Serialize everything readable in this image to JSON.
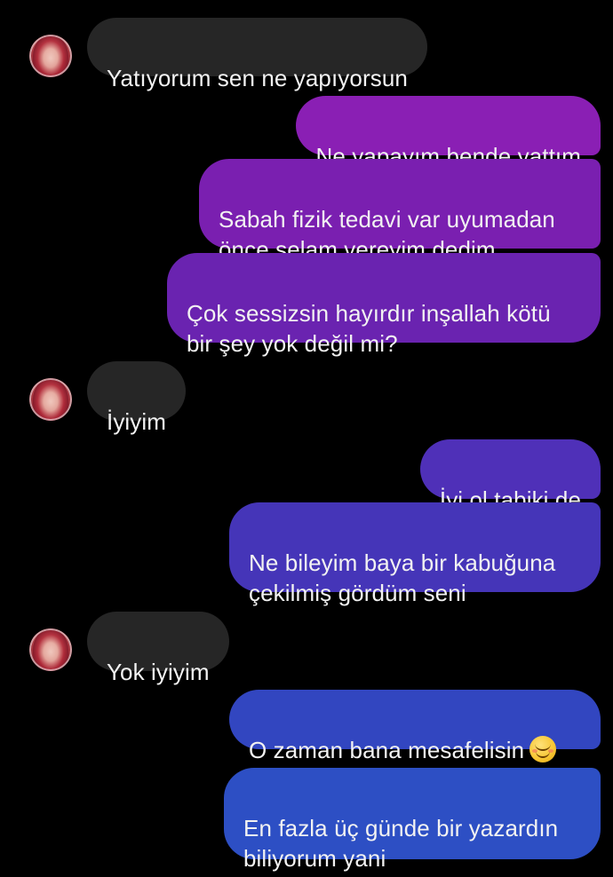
{
  "colors": {
    "background": "#000000",
    "incoming_bubble": "#262626",
    "outgoing_purple": "#7a1fb0",
    "outgoing_indigo": "#4a35b8",
    "outgoing_blue": "#2d4fc4"
  },
  "avatar_icon": "contact-avatar",
  "messages": [
    {
      "from": "them",
      "text": "Yatıyorum sen ne yapıyorsun"
    },
    {
      "from": "me",
      "text": "Ne yapayım bende yattım"
    },
    {
      "from": "me",
      "text": "Sabah fizik tedavi var uyumadan\nönce selam vereyim dedim"
    },
    {
      "from": "me",
      "text": "Çok sessizsin hayırdır inşallah kötü\nbir şey yok değil mi?"
    },
    {
      "from": "them",
      "text": "İyiyim"
    },
    {
      "from": "me",
      "text": "İyi ol tabiki de"
    },
    {
      "from": "me",
      "text": "Ne bileyim baya bir kabuğuna\nçekilmiş gördüm seni"
    },
    {
      "from": "them",
      "text": "Yok iyiyim"
    },
    {
      "from": "me",
      "text": "O zaman bana mesafelisin",
      "emoji": "smiling-face-emoji"
    },
    {
      "from": "me",
      "text": "En fazla üç günde bir yazardın\nbiliyorum yani"
    }
  ]
}
